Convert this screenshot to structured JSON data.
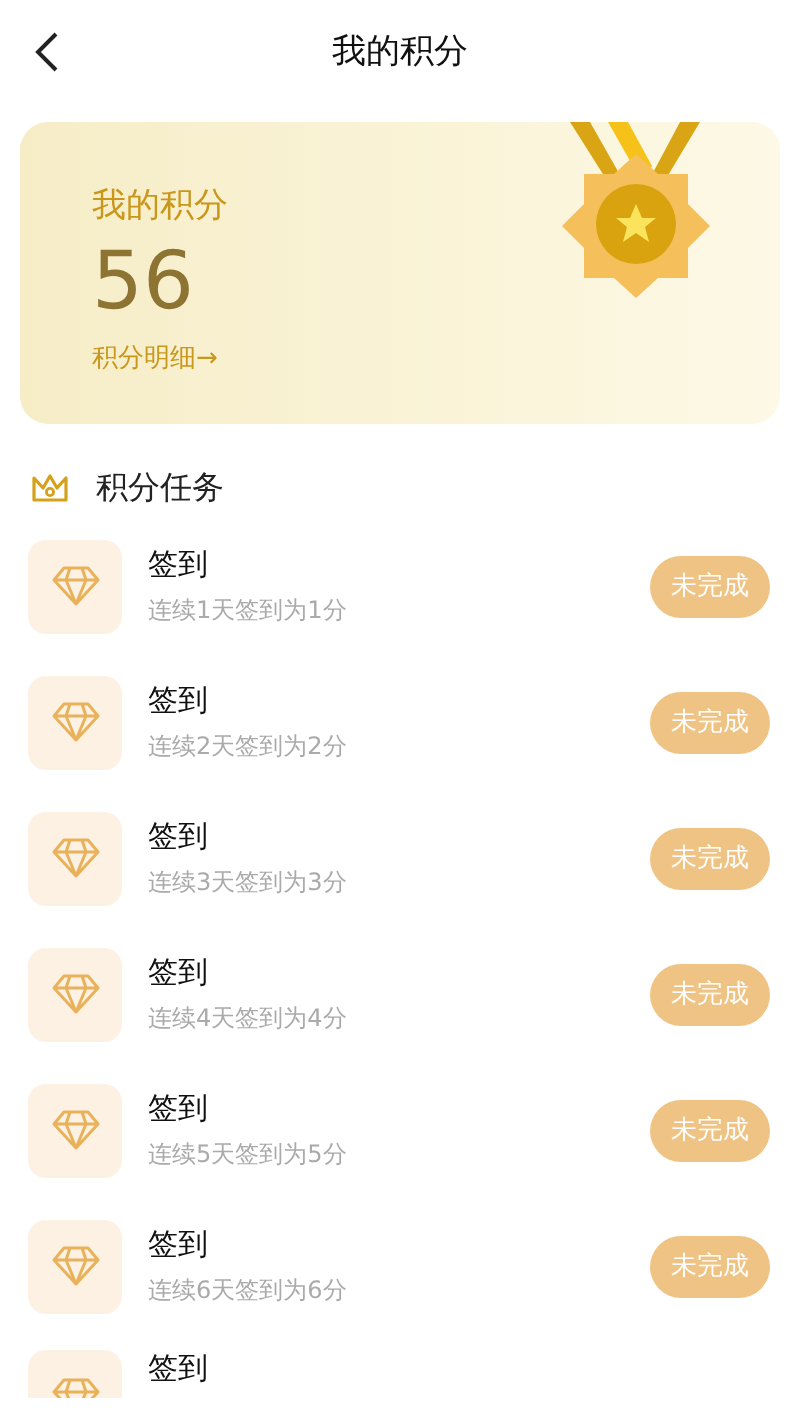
{
  "header": {
    "title": "我的积分"
  },
  "points_card": {
    "label": "我的积分",
    "value": "56",
    "link": "积分明细→"
  },
  "section": {
    "title": "积分任务"
  },
  "tasks": [
    {
      "title": "签到",
      "description": "连续1天签到为1分",
      "status": "未完成",
      "completed": false
    },
    {
      "title": "签到",
      "description": "连续2天签到为2分",
      "status": "未完成",
      "completed": false
    },
    {
      "title": "签到",
      "description": "连续3天签到为3分",
      "status": "未完成",
      "completed": false
    },
    {
      "title": "签到",
      "description": "连续4天签到为4分",
      "status": "未完成",
      "completed": false
    },
    {
      "title": "签到",
      "description": "连续5天签到为5分",
      "status": "未完成",
      "completed": false
    },
    {
      "title": "签到",
      "description": "连续6天签到为6分",
      "status": "未完成",
      "completed": false
    },
    {
      "title": "签到"
    }
  ]
}
